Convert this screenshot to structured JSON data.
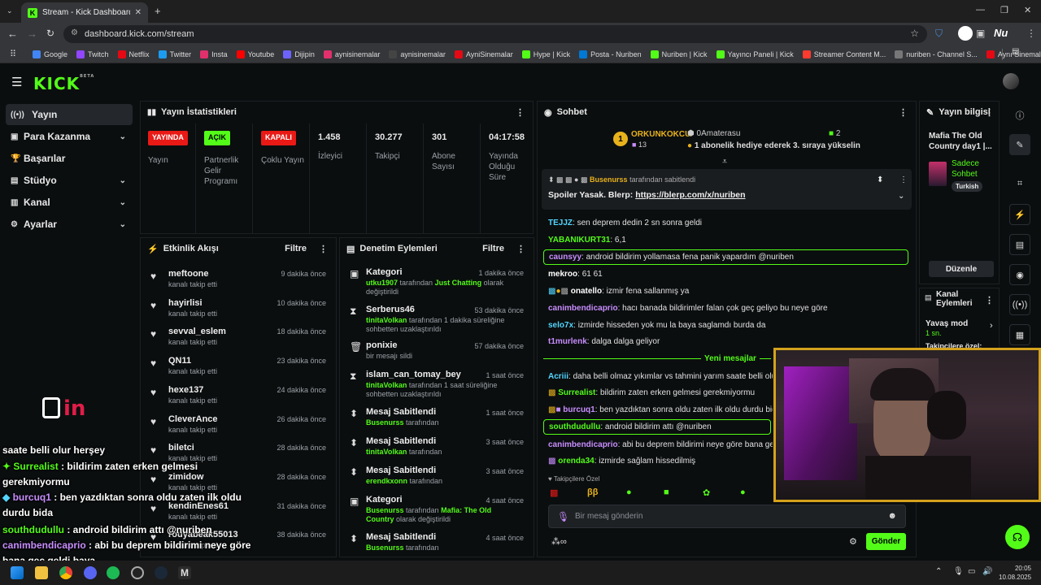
{
  "browser": {
    "tab_title": "Stream - Kick Dashboard",
    "url": "dashboard.kick.com/stream",
    "bookmarks": [
      "Google",
      "Twitch",
      "Netflix",
      "Twitter",
      "Insta",
      "Youtube",
      "Dijipin",
      "aynisinemalar",
      "aynisinemalar",
      "AyniSinemalar",
      "Hype | Kick",
      "Posta - Nuriben",
      "Nuriben | Kick",
      "Yayıncı Paneli | Kick",
      "Streamer Content M...",
      "nuriben - Channel S...",
      "Aynı Sinemalar - Ça..."
    ],
    "bookmark_colors": [
      "#4285f4",
      "#9146ff",
      "#e50914",
      "#1d9bf0",
      "#e1306c",
      "#ff0000",
      "#6c63ff",
      "#e1306c",
      "#444",
      "#e50914",
      "#53fc18",
      "#0078d4",
      "#53fc18",
      "#53fc18",
      "#ff3b30",
      "#777",
      "#e50914"
    ]
  },
  "header": {
    "logo": "KICK",
    "logo_sup": "BETA"
  },
  "sidebar": {
    "items": [
      {
        "label": "Yayın",
        "icon": "stream-icon"
      },
      {
        "label": "Para Kazanma",
        "icon": "money-icon"
      },
      {
        "label": "Başarılar",
        "icon": "trophy-icon"
      },
      {
        "label": "Stüdyo",
        "icon": "studio-icon"
      },
      {
        "label": "Kanal",
        "icon": "channel-icon"
      },
      {
        "label": "Ayarlar",
        "icon": "gear-icon"
      }
    ]
  },
  "stats": {
    "title": "Yayın İstatistikleri",
    "items": [
      {
        "value": "YAYINDA",
        "label": "Yayın",
        "color": "#e91916"
      },
      {
        "value": "AÇIK",
        "label": "Partnerlik Gelir Programı",
        "color": "#53fc18"
      },
      {
        "value": "KAPALI",
        "label": "Çoklu Yayın",
        "color": "#e91916"
      },
      {
        "value": "1.458",
        "label": "İzleyici"
      },
      {
        "value": "30.277",
        "label": "Takipçi"
      },
      {
        "value": "301",
        "label": "Abone Sayısı"
      },
      {
        "value": "04:17:58",
        "label": "Yayında Olduğu Süre"
      }
    ]
  },
  "activity": {
    "title": "Etkinlik Akışı",
    "filter": "Filtre",
    "items": [
      {
        "name": "meftoone",
        "sub": "kanalı takip etti",
        "time": "9 dakika önce"
      },
      {
        "name": "hayirlisi",
        "sub": "kanalı takip etti",
        "time": "10 dakika önce"
      },
      {
        "name": "sevval_eslem",
        "sub": "kanalı takip etti",
        "time": "18 dakika önce"
      },
      {
        "name": "QN11",
        "sub": "kanalı takip etti",
        "time": "23 dakika önce"
      },
      {
        "name": "hexe137",
        "sub": "kanalı takip etti",
        "time": "24 dakika önce"
      },
      {
        "name": "CleverAnce",
        "sub": "kanalı takip etti",
        "time": "26 dakika önce"
      },
      {
        "name": "biletci",
        "sub": "kanalı takip etti",
        "time": "28 dakika önce"
      },
      {
        "name": "zimidow",
        "sub": "kanalı takip etti",
        "time": "28 dakika önce"
      },
      {
        "name": "kendinEnes61",
        "sub": "kanalı takip etti",
        "time": "31 dakika önce"
      },
      {
        "name": "rouyabeak55013",
        "sub": "kanalı takip etti",
        "time": "38 dakika önce"
      }
    ]
  },
  "moderation": {
    "title": "Denetim Eylemleri",
    "filter": "Filtre",
    "items": [
      {
        "name": "Kategori",
        "actor": "utku1907",
        "rest": " tarafından ",
        "target": "Just Chatting",
        "tail": " olarak değiştirildi",
        "time": "1 dakika önce",
        "icon": "category-icon"
      },
      {
        "name": "Serberus46",
        "actor": "tinitaVolkan",
        "rest": " tarafından 1 dakika süreliğine sohbetten uzaklaştırıldı",
        "target": "",
        "tail": "",
        "time": "53 dakika önce",
        "icon": "hourglass-icon"
      },
      {
        "name": "ponixie",
        "actor": "",
        "rest": "bir mesajı sildi",
        "target": "",
        "tail": "",
        "time": "57 dakika önce",
        "icon": "trash-icon"
      },
      {
        "name": "islam_can_tomay_bey",
        "actor": "tinitaVolkan",
        "rest": " tarafından 1 saat süreliğine sohbetten uzaklaştırıldı",
        "target": "",
        "tail": "",
        "time": "1 saat önce",
        "icon": "hourglass-icon"
      },
      {
        "name": "Mesaj Sabitlendi",
        "actor": "Busenurss",
        "rest": " tarafından",
        "target": "",
        "tail": "",
        "time": "1 saat önce",
        "icon": "pin-icon"
      },
      {
        "name": "Mesaj Sabitlendi",
        "actor": "tinitaVolkan",
        "rest": " tarafından",
        "target": "",
        "tail": "",
        "time": "3 saat önce",
        "icon": "pin-icon"
      },
      {
        "name": "Mesaj Sabitlendi",
        "actor": "erendkxonn",
        "rest": " tarafından",
        "target": "",
        "tail": "",
        "time": "3 saat önce",
        "icon": "pin-icon"
      },
      {
        "name": "Kategori",
        "actor": "Busenurss",
        "rest": " tarafından ",
        "target": "Mafia: The Old Country",
        "tail": " olarak değiştirildi",
        "time": "4 saat önce",
        "icon": "category-icon"
      },
      {
        "name": "Mesaj Sabitlendi",
        "actor": "Busenurss",
        "rest": " tarafından",
        "target": "",
        "tail": "",
        "time": "4 saat önce",
        "icon": "pin-icon"
      }
    ]
  },
  "chat": {
    "title": "Sohbet",
    "top_gifter": {
      "name": "ORKUNKOKCU",
      "count": "13",
      "rank": "1"
    },
    "gift_user": "0Amaterasu",
    "gift_count": "2",
    "gift_text": "1 abonelik hediye ederek 3. sıraya yükselin",
    "pinned": {
      "by": "Busenurss",
      "by_text": "tarafından sabitlendi",
      "text": "Spoiler Yasak. Blerp: ",
      "link": "https://blerp.com/x/nuriben"
    },
    "messages": [
      {
        "user": "TEJJZ",
        "color": "#52d6ff",
        "text": "sen deprem dedin 2 sn sonra geldi"
      },
      {
        "user": "YABANIKURT31",
        "color": "#53fc18",
        "text": "6,1"
      },
      {
        "user": "caunsyy",
        "color": "#c88eff",
        "text": "android bildirim yollamasa fena panik yapardım @nuriben"
      },
      {
        "user": "mekroo",
        "color": "#ffffff",
        "text": "61 61"
      },
      {
        "user": "onatello",
        "color": "#ffffff",
        "text": "izmir fena sallanmış ya"
      },
      {
        "user": "canimbendicaprio",
        "color": "#c88eff",
        "text": "hacı banada bildirimler falan çok geç geliyo bu neye göre"
      },
      {
        "user": "selo7x",
        "color": "#52d6ff",
        "text": "izmirde hisseden yok mu la baya saglamdı burda da"
      },
      {
        "user": "t1murlenk",
        "color": "#c88eff",
        "text": "dalga dalga geliyor"
      },
      {
        "user": "Acriii",
        "color": "#52d6ff",
        "text": "daha belli olmaz yıkımlar vs tahmini yarım saate belli olur herşey"
      },
      {
        "user": "Surrealist",
        "color": "#53fc18",
        "text": "bildirim zaten erken gelmesi gerekmiyormu"
      },
      {
        "user": "burcuq1",
        "color": "#c88eff",
        "text": "ben yazdıktan sonra oldu zaten ilk oldu durdu bida"
      },
      {
        "user": "southdudullu",
        "color": "#53fc18",
        "text": "android bildirim attı @nuriben"
      },
      {
        "user": "canimbendicaprio",
        "color": "#c88eff",
        "text": "abi bu deprem bildirimi neye göre bana geç geldi baya"
      },
      {
        "user": "orenda34",
        "color": "#53fc18",
        "text": "izmirde sağlam hissedilmiş"
      }
    ],
    "new_messages": "Yeni mesajlar",
    "followers_only": "Takipçilere Özel",
    "input_placeholder": "Bir mesaj gönderin",
    "send": "Gönder"
  },
  "stream_info": {
    "title": "Yayın bilgisi",
    "stream_title": "Mafia The Old Country day1 |...",
    "category": "Sadece Sohbet",
    "language": "Turkish",
    "edit": "Düzenle"
  },
  "channel_actions": {
    "title": "Kanal Eylemleri",
    "slow_mode": "Yavaş mod",
    "slow_value": "1 sn.",
    "followers_text": "Takipçilere özel:"
  },
  "overlay": {
    "logo": "in",
    "lines": [
      {
        "user": "",
        "text": "saate belli olur herşey"
      },
      {
        "user": "Surrealist",
        "text": " : bildirim zaten erken gelmesi",
        "color": "#53fc18"
      },
      {
        "user": "",
        "text": "gerekmiyormu"
      },
      {
        "user": "burcuq1",
        "text": " : ben yazdıktan sonra oldu zaten ilk oldu",
        "color": "#c88eff"
      },
      {
        "user": "",
        "text": "durdu bida"
      },
      {
        "user": "southdudullu",
        "text": " : android bildirim attı @nuriben",
        "color": "#53fc18"
      },
      {
        "user": "canimbendicaprio",
        "text": " : abi bu deprem bildirimi neye göre",
        "color": "#c88eff"
      },
      {
        "user": "",
        "text": "bana geç geldi baya"
      }
    ]
  },
  "taskbar": {
    "time": "20:05",
    "date": "10.08.2025"
  }
}
